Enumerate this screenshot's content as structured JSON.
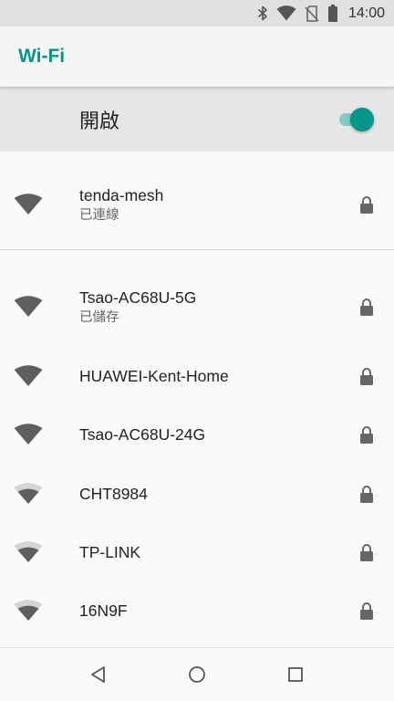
{
  "status_bar": {
    "time": "14:00",
    "icons": [
      "bluetooth-icon",
      "wifi-signal-icon",
      "no-sim-icon",
      "battery-icon"
    ]
  },
  "app_bar": {
    "title": "Wi-Fi"
  },
  "master_switch": {
    "label": "開啟",
    "state": "on"
  },
  "networks": [
    {
      "ssid": "tenda-mesh",
      "status": "已連線",
      "signal": "full",
      "secured": true
    },
    {
      "ssid": "Tsao-AC68U-5G",
      "status": "已儲存",
      "signal": "full",
      "secured": true
    },
    {
      "ssid": "HUAWEI-Kent-Home",
      "status": "",
      "signal": "full",
      "secured": true
    },
    {
      "ssid": "Tsao-AC68U-24G",
      "status": "",
      "signal": "full",
      "secured": true
    },
    {
      "ssid": "CHT8984",
      "status": "",
      "signal": "medium",
      "secured": true
    },
    {
      "ssid": "TP-LINK",
      "status": "",
      "signal": "medium",
      "secured": true
    },
    {
      "ssid": "16N9F",
      "status": "",
      "signal": "medium",
      "secured": true
    }
  ],
  "navigation": [
    "back-icon",
    "home-icon",
    "recents-icon"
  ],
  "colors": {
    "accent": "#009688",
    "accent_light": "#80cbc4"
  }
}
